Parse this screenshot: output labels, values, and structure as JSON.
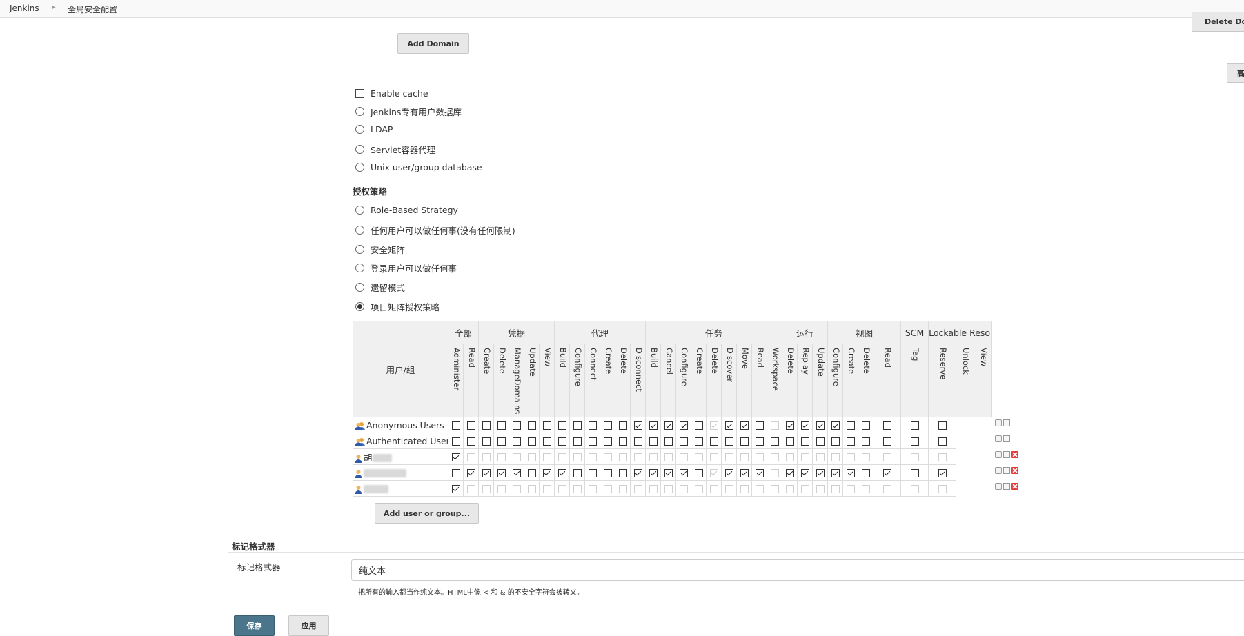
{
  "breadcrumb": [
    "Jenkins",
    "全局安全配置"
  ],
  "buttons": {
    "delete_domain": "Delete Domain",
    "add_domain": "Add Domain",
    "advanced": "高级",
    "add_user_group": "Add user or group...",
    "save": "保存",
    "apply": "应用"
  },
  "enable_cache": "Enable cache",
  "security_realms": [
    "Jenkins专有用户数据库",
    "LDAP",
    "Servlet容器代理",
    "Unix user/group database"
  ],
  "authorization": {
    "title": "授权策略",
    "options": [
      "Role-Based Strategy",
      "任何用户可以做任何事(没有任何限制)",
      "安全矩阵",
      "登录用户可以做任何事",
      "遗留模式",
      "项目矩阵授权策略"
    ],
    "selected_index": 5
  },
  "matrix": {
    "user_header": "用户/组",
    "groups": [
      {
        "name": "全部",
        "perms": [
          "Administer",
          "Read"
        ]
      },
      {
        "name": "凭据",
        "perms": [
          "Create",
          "Delete",
          "ManageDomains",
          "Update",
          "View"
        ]
      },
      {
        "name": "代理",
        "perms": [
          "Build",
          "Configure",
          "Connect",
          "Create",
          "Delete",
          "Disconnect"
        ]
      },
      {
        "name": "任务",
        "perms": [
          "Build",
          "Cancel",
          "Configure",
          "Create",
          "Delete",
          "Discover",
          "Move",
          "Read",
          "Workspace"
        ]
      },
      {
        "name": "运行",
        "perms": [
          "Delete",
          "Replay",
          "Update"
        ]
      },
      {
        "name": "视图",
        "perms": [
          "Configure",
          "Create",
          "Delete",
          "Read"
        ]
      },
      {
        "name": "SCM",
        "perms": [
          "Tag"
        ]
      },
      {
        "name": "Lockable Resources",
        "perms": [
          "Reserve",
          "Unlock",
          "View"
        ]
      }
    ],
    "rows": [
      {
        "user": "Anonymous Users",
        "type": "group",
        "checks": "0000000000001111011100111100000",
        "disabled": "0000000000000000010001000000000"
      },
      {
        "user": "Authenticated Users",
        "type": "group",
        "checks": "0000000000000000000000000000000",
        "disabled": "0000000000000000000000000000000"
      },
      {
        "user": "胡",
        "type": "user",
        "checks": "1000000000000000000000000000000",
        "disabled": "0111111111111111111111111111111"
      },
      {
        "user": "",
        "type": "user",
        "checks": "0111101100001111011110111110101",
        "disabled": "0000000000000000010001000000000"
      },
      {
        "user": "",
        "type": "user",
        "checks": "1000000000000000000000000000000",
        "disabled": "0111111111111111111111111111111"
      }
    ]
  },
  "markup_formatter": {
    "section_title": "标记格式器",
    "label": "标记格式器",
    "selected": "纯文本",
    "description": "把所有的输入都当作纯文本。HTML中像 < 和 & 的不安全字符会被转义。"
  }
}
